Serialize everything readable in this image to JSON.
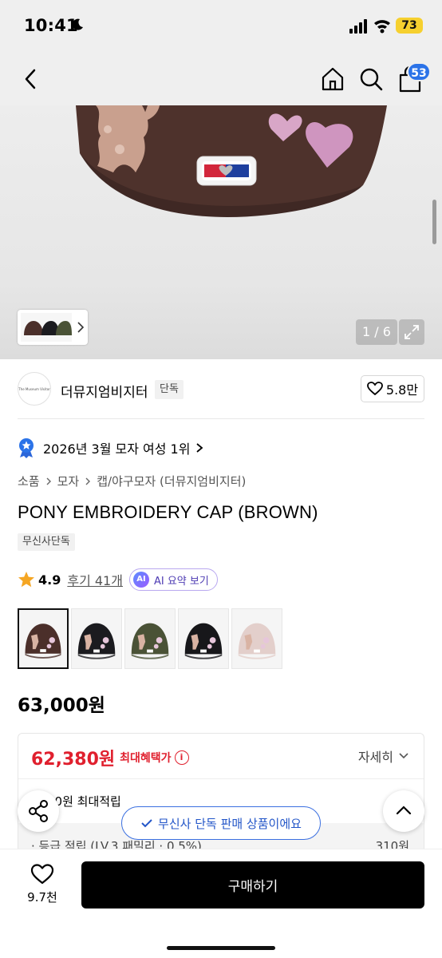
{
  "status_bar": {
    "time": "10:41",
    "battery": "73"
  },
  "header": {
    "cart_count": "53"
  },
  "gallery": {
    "counter": "1 / 6"
  },
  "brand": {
    "logo_text": "The Museum Visitor",
    "name": "더뮤지엄비지터",
    "badge": "단독",
    "likes": "5.8만"
  },
  "ranking": {
    "text": "2026년 3월 모자 여성 1위"
  },
  "breadcrumb": [
    "소품",
    "모자",
    "캡/야구모자 (더뮤지엄비지터)"
  ],
  "product": {
    "title": "PONY EMBROIDERY CAP (BROWN)",
    "exclusive_tag": "무신사단독",
    "rating": "4.9",
    "reviews": "후기 41개",
    "ai_badge": "AI",
    "ai_summary": "AI 요약 보기",
    "price": "63,000원"
  },
  "color_options": [
    {
      "name": "brown",
      "color": "#4b2f2a",
      "selected": true
    },
    {
      "name": "black",
      "color": "#1b1b1f",
      "selected": false
    },
    {
      "name": "camo",
      "color": "#4a5236",
      "selected": false
    },
    {
      "name": "black-2",
      "color": "#17171a",
      "selected": false
    },
    {
      "name": "pink",
      "color": "#e3cfcb",
      "selected": false
    }
  ],
  "benefit": {
    "price": "62,380원",
    "label": "최대혜택가",
    "info": "i",
    "detail": "자세히",
    "points_max": "50원 최대적립",
    "points_row": "· 등급 적립 (LV.3 패밀리 · 0.5%)",
    "points_amount": "310원"
  },
  "toast": {
    "text": "무신사 단독 판매 상품이에요"
  },
  "bottom": {
    "wish_count": "9.7천",
    "buy_label": "구매하기"
  }
}
